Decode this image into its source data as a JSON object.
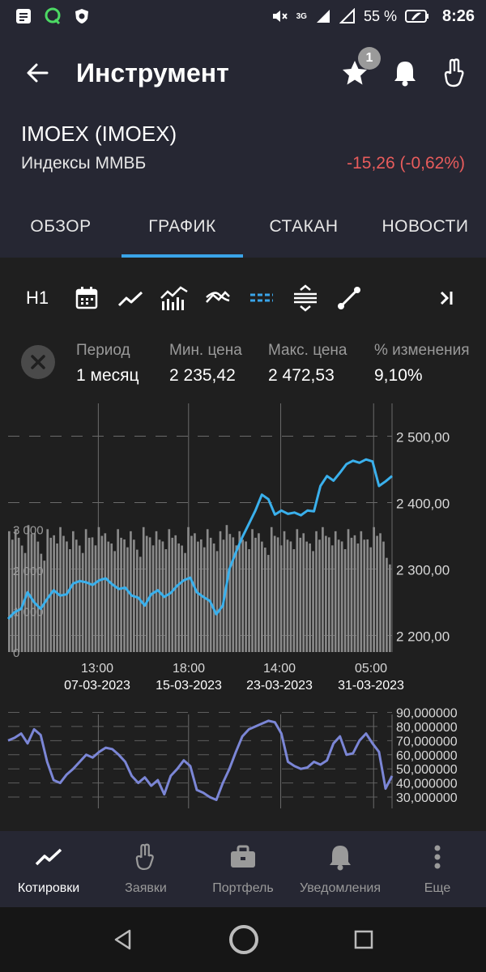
{
  "status": {
    "battery": "55 %",
    "time": "8:26",
    "network": "3G"
  },
  "header": {
    "title": "Инструмент",
    "favorites_badge": "1"
  },
  "instrument": {
    "name": "IMOEX (IMOEX)",
    "group": "Индексы ММВБ",
    "change": "-15,26 (-0,62%)"
  },
  "tabs": [
    {
      "label": "ОБЗОР"
    },
    {
      "label": "ГРАФИК"
    },
    {
      "label": "СТАКАН"
    },
    {
      "label": "НОВОСТИ"
    }
  ],
  "chart_toolbar": {
    "timeframe": "H1"
  },
  "info": {
    "period_label": "Период",
    "period_value": "1 месяц",
    "min_label": "Мин. цена",
    "min_value": "2 235,42",
    "max_label": "Макс. цена",
    "max_value": "2 472,53",
    "change_label": "% изменения",
    "change_value": "9,10%"
  },
  "bottom_nav": [
    {
      "label": "Котировки"
    },
    {
      "label": "Заявки"
    },
    {
      "label": "Портфель"
    },
    {
      "label": "Уведомления"
    },
    {
      "label": "Еще"
    }
  ],
  "colors": {
    "price_line": "#3ab0ec",
    "volume_bars": "#8a8a8a",
    "oscillator_line": "#7b86d6",
    "negative": "#e85c5c",
    "accent": "#3aa4e8"
  },
  "chart_data": [
    {
      "type": "line",
      "y_axis_labels": [
        "2 500,00",
        "2 400,00",
        "2 300,00",
        "2 200,00"
      ],
      "volume_axis_labels": [
        "3 000",
        "2 000",
        "1 000",
        "0"
      ],
      "x_tick_times": [
        "13:00",
        "18:00",
        "14:00",
        "05:00"
      ],
      "x_tick_dates": [
        "07-03-2023",
        "15-03-2023",
        "23-03-2023",
        "31-03-2023"
      ],
      "ylim": [
        2175,
        2525
      ],
      "series": [
        {
          "values": [
            2225,
            2235,
            2240,
            2265,
            2250,
            2240,
            2255,
            2268,
            2260,
            2262,
            2278,
            2282,
            2280,
            2276,
            2283,
            2286,
            2277,
            2270,
            2272,
            2260,
            2257,
            2245,
            2262,
            2268,
            2258,
            2264,
            2275,
            2283,
            2287,
            2265,
            2258,
            2252,
            2232,
            2245,
            2300,
            2325,
            2348,
            2368,
            2388,
            2412,
            2405,
            2382,
            2388,
            2383,
            2385,
            2381,
            2388,
            2387,
            2425,
            2440,
            2433,
            2445,
            2458,
            2463,
            2460,
            2465,
            2462,
            2425,
            2432,
            2440
          ]
        }
      ],
      "volume_values": [
        2950,
        3000,
        2600,
        3100,
        2900,
        2400,
        3000,
        2850,
        3050,
        2700,
        2950,
        2600,
        3000,
        2800,
        3050,
        2900,
        2650,
        3000,
        2750,
        2950,
        2500,
        3050,
        2800,
        2950,
        2700,
        3000,
        2850,
        2600,
        3050,
        2900,
        2750,
        3000,
        2650,
        2950,
        3100,
        2800,
        2950,
        2700,
        3000,
        2900,
        2550,
        3050,
        2800,
        2950,
        2700,
        3000,
        2900,
        2650,
        2950,
        3050,
        2800,
        2950,
        2700,
        3000,
        2850,
        2950,
        2750,
        3050,
        2900,
        2300
      ],
      "volume_ylim": [
        0,
        3500
      ]
    },
    {
      "type": "line",
      "y_axis_labels": [
        "90,000000",
        "80,000000",
        "70,000000",
        "60,000000",
        "50,000000",
        "40,000000",
        "30,000000"
      ],
      "ylim": [
        22,
        92
      ],
      "series": [
        {
          "values": [
            70,
            72,
            75,
            68,
            78,
            74,
            55,
            42,
            40,
            46,
            50,
            55,
            60,
            58,
            62,
            65,
            64,
            60,
            55,
            45,
            40,
            44,
            38,
            42,
            32,
            45,
            50,
            56,
            52,
            35,
            33,
            30,
            28,
            40,
            50,
            62,
            73,
            78,
            80,
            82,
            84,
            83,
            75,
            55,
            52,
            50,
            51,
            55,
            53,
            56,
            68,
            73,
            60,
            61,
            70,
            75,
            68,
            62,
            36,
            45
          ]
        }
      ]
    }
  ]
}
